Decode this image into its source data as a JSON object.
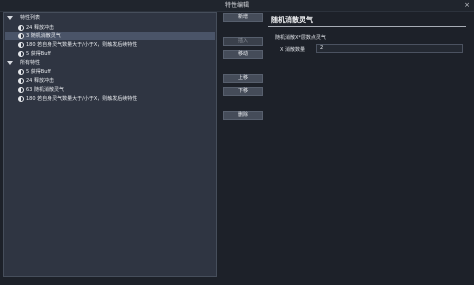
{
  "window": {
    "title": "特性编辑",
    "close_glyph": "×"
  },
  "tree": {
    "groups": [
      {
        "label": "特性列表",
        "items": [
          {
            "label": "24 释放冲击",
            "icon": "half-circle-icon"
          },
          {
            "label": "3 随机消散灵气",
            "icon": "half-circle-icon",
            "selected": true
          },
          {
            "label": "180 若自身灵气数量大于/小于X，则触发后续特性",
            "icon": "half-circle-icon"
          },
          {
            "label": "5 获得Buff",
            "icon": "half-circle-icon"
          }
        ]
      },
      {
        "label": "所有特性",
        "items": [
          {
            "label": "5 获得Buff",
            "icon": "half-circle-icon"
          },
          {
            "label": "24 释放冲击",
            "icon": "half-circle-icon"
          },
          {
            "label": "63 随机消散灵气",
            "icon": "half-circle-icon"
          },
          {
            "label": "180 若自身灵气数量大于/小于X，则触发后续特性",
            "icon": "half-circle-icon"
          }
        ]
      }
    ]
  },
  "buttons": {
    "add": "新增",
    "insert": "插入",
    "move": "移动",
    "up": "上移",
    "down": "下移",
    "delete": "删除"
  },
  "detail": {
    "title": "随机消散灵气",
    "description": "随机消散X*层数点灵气",
    "field_label": "X 消散数量",
    "field_value": "2"
  }
}
